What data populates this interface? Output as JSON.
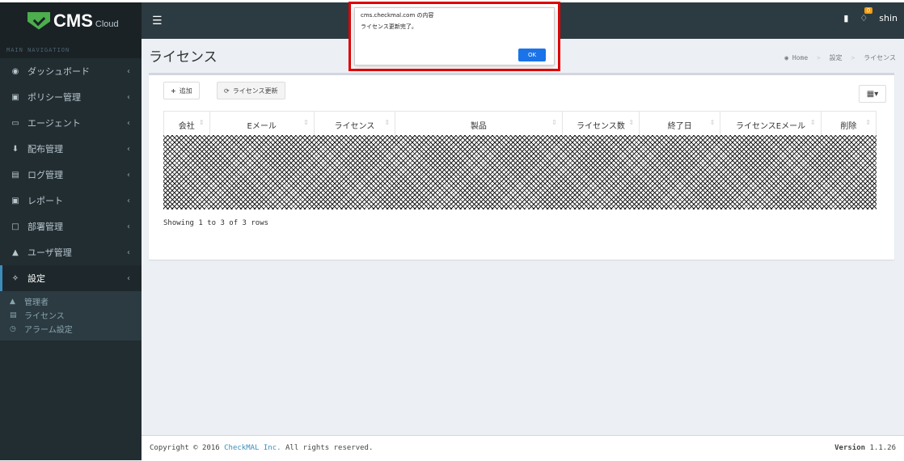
{
  "app": {
    "logo_text": "CMS",
    "logo_sub": "Cloud",
    "user_name": "shin",
    "notification_count": "0"
  },
  "sidebar": {
    "header": "MAIN NAVIGATION",
    "items": [
      {
        "label": "ダッシュボード",
        "icon": "dashboard-icon"
      },
      {
        "label": "ポリシー管理",
        "icon": "table-icon"
      },
      {
        "label": "エージェント",
        "icon": "monitor-icon"
      },
      {
        "label": "配布管理",
        "icon": "download-icon"
      },
      {
        "label": "ログ管理",
        "icon": "list-icon"
      },
      {
        "label": "レポート",
        "icon": "report-icon"
      },
      {
        "label": "部署管理",
        "icon": "folder-icon"
      },
      {
        "label": "ユーザ管理",
        "icon": "user-icon"
      },
      {
        "label": "設定",
        "icon": "wrench-icon"
      }
    ],
    "sub_items": [
      {
        "label": "管理者",
        "icon": "admin-icon"
      },
      {
        "label": "ライセンス",
        "icon": "card-icon"
      },
      {
        "label": "アラーム設定",
        "icon": "clock-icon"
      }
    ]
  },
  "page": {
    "title": "ライセンス",
    "breadcrumb": [
      "Home",
      "設定",
      "ライセンス"
    ]
  },
  "toolbar": {
    "add_label": "追加",
    "renew_label": "ライセンス更新"
  },
  "table": {
    "columns": [
      "会社",
      "Eメール",
      "ライセンス",
      "製品",
      "ライセンス数",
      "終了日",
      "ライセンスEメール",
      "削除"
    ],
    "showing": "Showing 1 to 3 of 3 rows"
  },
  "footer": {
    "copyright_prefix": "Copyright © 2016",
    "company": "CheckMAL Inc.",
    "copyright_suffix": "All rights reserved.",
    "version_label": "Version",
    "version": "1.1.26"
  },
  "dialog": {
    "origin": "cms.checkmal.com の内容",
    "message": "ライセンス更新完了。",
    "ok_label": "OK"
  },
  "colors": {
    "sidebar_bg": "#222d32",
    "accent": "#3c8dbc",
    "dialog_highlight": "#e00000"
  }
}
